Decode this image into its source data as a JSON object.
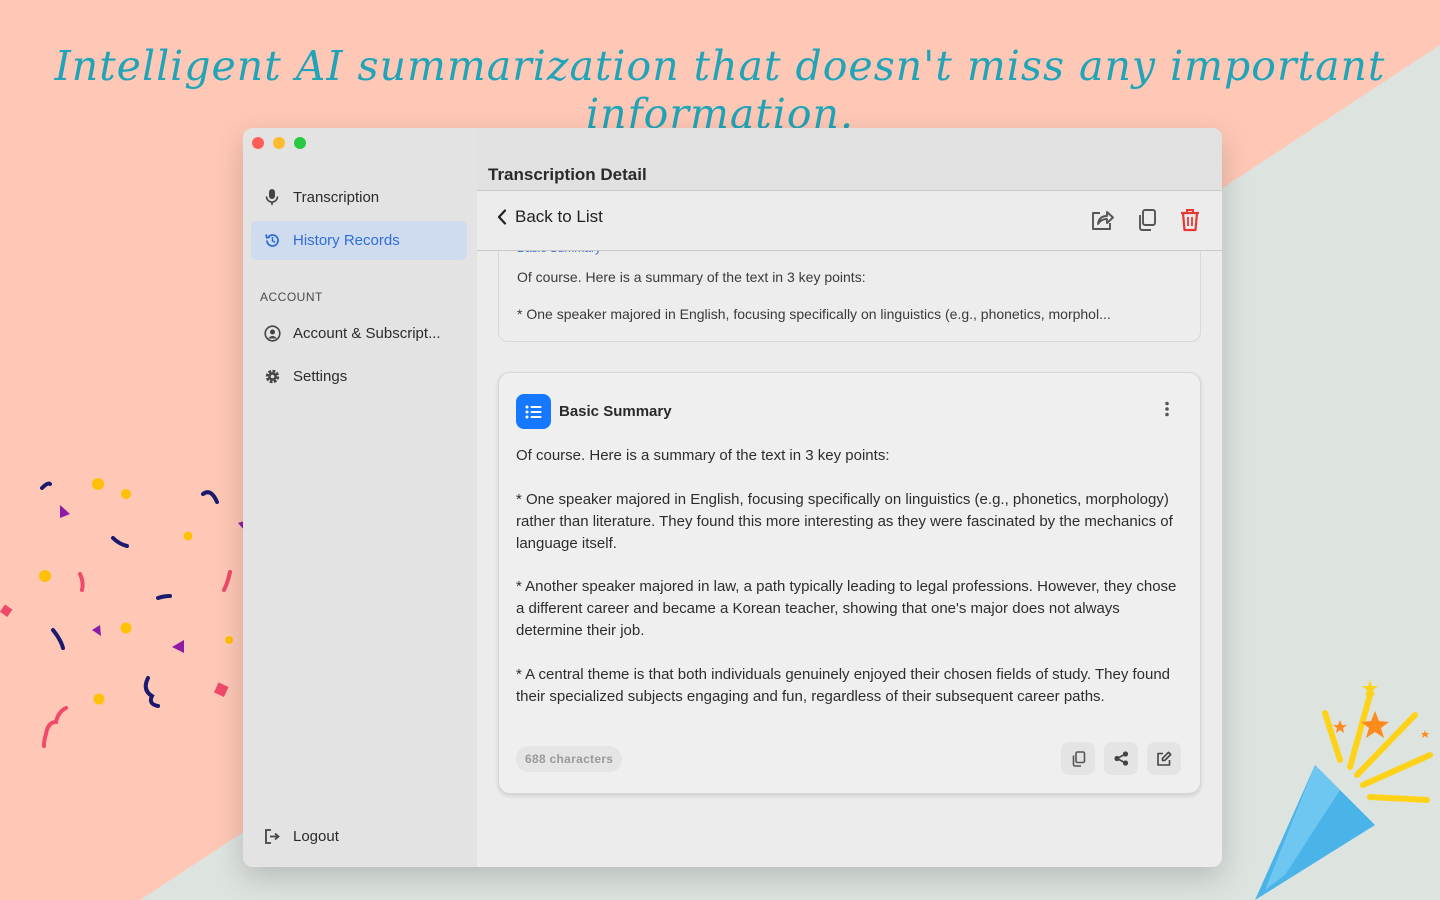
{
  "headline": "Intelligent AI summarization that doesn't miss any important information.",
  "colors": {
    "background_peach": "#ffc8b6",
    "background_gray": "#dde3df",
    "headline": "#1fa4b8",
    "accent_blue": "#2f6ed8",
    "badge_blue": "#1677ff",
    "delete_red": "#e53935"
  },
  "window": {
    "traffic_lights": [
      "close",
      "minimize",
      "zoom"
    ]
  },
  "sidebar": {
    "items": [
      {
        "label": "Transcription",
        "icon": "microphone-icon",
        "active": false
      },
      {
        "label": "History Records",
        "icon": "history-icon",
        "active": true
      }
    ],
    "account_section_label": "ACCOUNT",
    "account_items": [
      {
        "label": "Account & Subscript...",
        "icon": "user-circle-icon"
      },
      {
        "label": "Settings",
        "icon": "gear-icon"
      }
    ],
    "logout_label": "Logout"
  },
  "main": {
    "title": "Transcription Detail",
    "back_label": "Back to List",
    "toolbar_icons": [
      "share-icon",
      "copy-icon",
      "trash-icon"
    ]
  },
  "previous_card": {
    "partial_title": "Basic Summary",
    "line1": "Of course. Here is a summary of the text in 3 key points:",
    "line2": "*   One speaker majored in English, focusing specifically on linguistics (e.g., phonetics, morphol..."
  },
  "summary_card": {
    "title": "Basic Summary",
    "intro": "Of course. Here is a summary of the text in 3 key points:",
    "points": [
      "*   One speaker majored in English, focusing specifically on linguistics (e.g., phonetics, morphology) rather than literature. They found this more interesting as they were fascinated by the mechanics of language itself.",
      "*   Another speaker majored in law, a path typically leading to legal professions. However, they chose a different career and became a Korean teacher, showing that one's major does not always determine their job.",
      "*   A central theme is that both individuals genuinely enjoyed their chosen fields of study. They found their specialized subjects engaging and fun, regardless of their subsequent career paths."
    ],
    "char_count": "688 characters",
    "action_icons": [
      "copy-icon",
      "share-nodes-icon",
      "edit-icon"
    ]
  }
}
